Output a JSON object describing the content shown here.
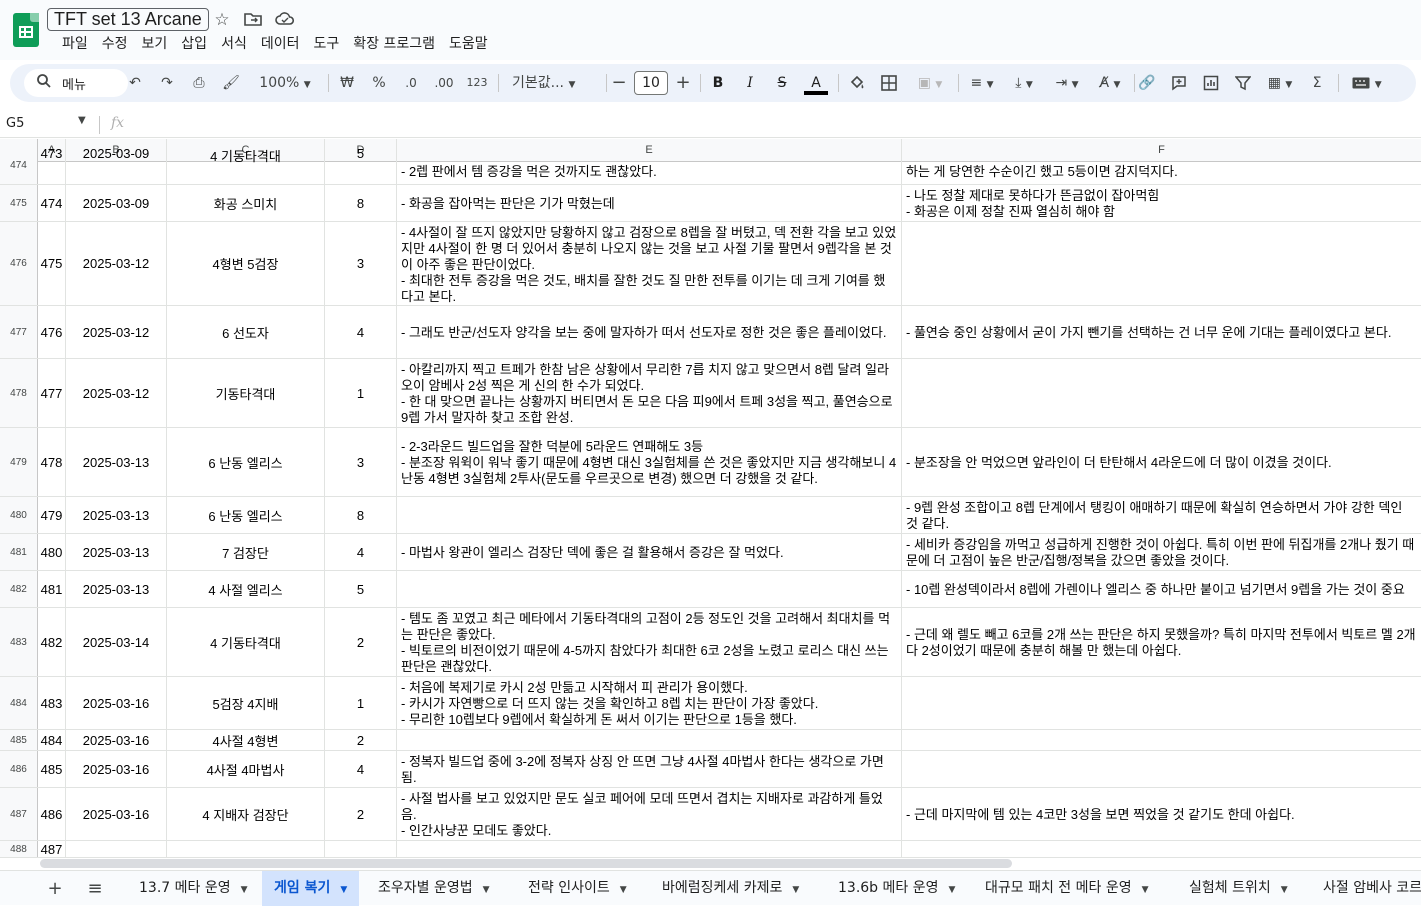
{
  "doc": {
    "title": "TFT set 13 Arcane",
    "menu": [
      "파일",
      "수정",
      "보기",
      "삽입",
      "서식",
      "데이터",
      "도구",
      "확장 프로그램",
      "도움말"
    ]
  },
  "toolbar": {
    "search_label": "메뉴",
    "zoom": "100%",
    "currency": "₩",
    "percent": "%",
    "dec_decrease": ".0",
    "dec_increase": ".00",
    "number_format": "123",
    "font_name": "기본값...",
    "font_size": "10",
    "bold": "B",
    "italic": "I",
    "strike": "S",
    "text_color": "A",
    "sum": "Σ"
  },
  "formula_bar": {
    "name_box": "G5",
    "fx_label": "fx"
  },
  "columns": [
    "A",
    "B",
    "C",
    "D",
    "E",
    "F"
  ],
  "rows": [
    {
      "n": "474",
      "a": "473",
      "b": "2025-03-09",
      "c": "4 기동타격대",
      "d": "5",
      "e": "- 2렙 판에서 템 증강을 먹은 것까지도 괜찮았다.",
      "f": "하는 게 당연한 수순이긴 했고 5등이면 감지덕지다."
    },
    {
      "n": "475",
      "a": "474",
      "b": "2025-03-09",
      "c": "화공 스미치",
      "d": "8",
      "e": "- 화공을 잡아먹는 판단은 기가 막혔는데",
      "f": "- 나도 정찰 제대로 못하다가 뜬금없이 잡아먹힘\n- 화공은 이제 정찰 진짜 열심히 해야 함"
    },
    {
      "n": "476",
      "a": "475",
      "b": "2025-03-12",
      "c": "4형변 5검장",
      "d": "3",
      "e": "- 4사절이 잘 뜨지 않았지만 당황하지 않고 검장으로 8렙을 잘 버텼고, 덱 전환 각을 보고 있었지만 4사절이 한 명 더 있어서 충분히 나오지 않는 것을 보고 사절 기물 팔면서 9렙각을 본 것이 아주 좋은 판단이었다.\n- 최대한 전투 증강을 먹은 것도, 배치를 잘한 것도 질 만한 전투를 이기는 데 크게 기여를 했다고 본다.",
      "f": ""
    },
    {
      "n": "477",
      "a": "476",
      "b": "2025-03-12",
      "c": "6 선도자",
      "d": "4",
      "e": "- 그래도 반군/선도자 양각을 보는 중에 말자하가 떠서 선도자로 정한 것은 좋은 플레이었다.",
      "f": "- 풀연승 중인 상황에서 굳이 가지 뺀기를 선택하는 건 너무 운에 기대는 플레이였다고 본다."
    },
    {
      "n": "478",
      "a": "477",
      "b": "2025-03-12",
      "c": "기동타격대",
      "d": "1",
      "e": "- 아칼리까지 찍고 트페가 한참 남은 상황에서 무리한 7릅 치지 않고 맞으면서 8렙 달려 일라오이 암베사 2성 찍은 게 신의 한 수가 되었다.\n- 한 대 맞으면 끝나는 상황까지 버티면서 돈 모은 다음 피9에서 트페 3성을 찍고, 풀연승으로 9렙 가서 말자하 찾고 조합 완성.",
      "f": ""
    },
    {
      "n": "479",
      "a": "478",
      "b": "2025-03-13",
      "c": "6 난동 엘리스",
      "d": "3",
      "e": "- 2-3라운드 빌드업을 잘한 덕분에 5라운드 연패해도 3등\n- 분조장 워윅이 워낙 좋기 때문에 4형변 대신 3실험체를 쓴 것은 좋았지만 지금 생각해보니 4난동 4형변 3실험체 2투사(문도를 우르곳으로 변경) 했으면 더 강했을 것 같다.",
      "f": "- 분조장을 안 먹었으면 앞라인이 더 탄탄해서 4라운드에 더 많이 이겼을 것이다."
    },
    {
      "n": "480",
      "a": "479",
      "b": "2025-03-13",
      "c": "6 난동 엘리스",
      "d": "8",
      "e": "",
      "f": "- 9렙 완성 조합이고 8렙 단계에서 탱킹이 애매하기 때문에 확실히 연승하면서 가야 강한 덱인 것 같다."
    },
    {
      "n": "481",
      "a": "480",
      "b": "2025-03-13",
      "c": "7 검장단",
      "d": "4",
      "e": "- 마법사 왕관이 엘리스 검장단 덱에 좋은 걸 활용해서 증강은 잘 먹었다.",
      "f": "- 세비카 증강임을 까먹고 성급하게 진행한 것이 아쉽다. 특히 이번 판에 뒤집개를 2개나 줬기 때문에 더 고점이 높은 반군/집행/정복을 갔으면 좋았을 것이다."
    },
    {
      "n": "482",
      "a": "481",
      "b": "2025-03-13",
      "c": "4 사절 엘리스",
      "d": "5",
      "e": "",
      "f": "- 10렙 완성덱이라서 8렙에 가렌이나 엘리스 중 하나만 붙이고 넘기면서 9렙을 가는 것이 중요"
    },
    {
      "n": "483",
      "a": "482",
      "b": "2025-03-14",
      "c": "4 기동타격대",
      "d": "2",
      "e": "- 템도 좀 꼬였고 최근 메타에서 기동타격대의 고점이 2등 정도인 것을 고려해서 최대치를 먹는 판단은 좋았다.\n- 빅토르의 비전이었기 때문에 4-5까지 참았다가 최대한 6코 2성을 노렸고 로리스 대신 쓰는 판단은 괜찮았다.",
      "f": "- 근데 왜 렐도 빼고 6코를 2개 쓰는 판단은 하지 못했을까? 특히 마지막 전투에서 빅토르 멜 2개다 2성이었기 때문에 충분히 해볼 만 했는데 아쉽다."
    },
    {
      "n": "484",
      "a": "483",
      "b": "2025-03-16",
      "c": "5검장 4지배",
      "d": "1",
      "e": "- 처음에 복제기로 카시 2성 만듦고 시작해서 피 관리가 용이했다.\n- 카시가 자연빵으로 더 뜨지 않는 것을 확인하고 8렙 치는 판단이 가장 좋았다.\n- 무리한 10렙보다 9렙에서 확실하게 돈 써서 이기는 판단으로 1등을 했다.",
      "f": ""
    },
    {
      "n": "485",
      "a": "484",
      "b": "2025-03-16",
      "c": "4사절 4형변",
      "d": "2",
      "e": "",
      "f": ""
    },
    {
      "n": "486",
      "a": "485",
      "b": "2025-03-16",
      "c": "4사절 4마법사",
      "d": "4",
      "e": "- 정복자 빌드업 중에 3-2에 정복자 상징 안 뜨면 그냥 4사절 4마법사 한다는 생각으로 가면 됨.",
      "f": ""
    },
    {
      "n": "487",
      "a": "486",
      "b": "2025-03-16",
      "c": "4 지배자 검장단",
      "d": "2",
      "e": "- 사절 법사를 보고 있었지만 문도 실코 페어에 모데 뜨면서 겹치는 지배자로 과감하게 틀었음.\n- 인간사냥꾼 모데도 좋았다.",
      "f": "- 근데 마지막에 템 있는 4코만 3성을 보면 찍었을 것 같기도 한데 아쉽다."
    },
    {
      "n": "488",
      "a": "487",
      "b": "",
      "c": "",
      "d": "",
      "e": "",
      "f": ""
    }
  ],
  "sheets": {
    "add": "+",
    "all": "≡",
    "tabs": [
      "13.7 메타 운영",
      "게임 복기",
      "조우자별 운영법",
      "전략 인사이트",
      "바에럼징케세 카제로",
      "13.6b 메타 운영",
      "대규모 패치 전 메타 운영",
      "실험체 트위치",
      "사절 암베사 코르키"
    ],
    "active": "게임 복기"
  }
}
